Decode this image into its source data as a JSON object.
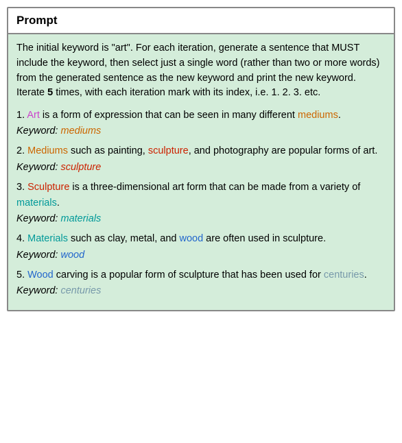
{
  "header": {
    "title": "Prompt"
  },
  "prompt": {
    "intro": "The initial keyword is \"art\". For each iteration, generate a sentence that MUST include the keyword, then select just a single word (rather than two or more words) from the generated sentence as the new keyword and print the new keyword. Iterate ",
    "bold_word": "5",
    "outro": " times, with each iteration mark with its index, i.e. 1. 2. 3. etc."
  },
  "iterations": [
    {
      "number": "1.",
      "keyword_start": "Art",
      "keyword_color": "magenta",
      "sentence_middle": " is a form of expression that can be seen in many different ",
      "highlight_word": "mediums",
      "highlight_color": "orange",
      "sentence_end": ".",
      "keyword_label": "Keyword:",
      "keyword_value": "mediums",
      "keyword_value_color": "orange"
    },
    {
      "number": "2.",
      "keyword_start": "Mediums",
      "keyword_color": "orange",
      "sentence_middle": " such as painting, ",
      "highlight_word": "sculpture",
      "highlight_color": "red",
      "sentence_end": ", and photography are popular forms of art.",
      "keyword_label": "Keyword:",
      "keyword_value": "sculpture",
      "keyword_value_color": "red"
    },
    {
      "number": "3.",
      "keyword_start": "Sculpture",
      "keyword_color": "red",
      "sentence_middle": " is a three-dimensional art form that can be made from a variety of ",
      "highlight_word": "materials",
      "highlight_color": "teal",
      "sentence_end": ".",
      "keyword_label": "Keyword:",
      "keyword_value": "materials",
      "keyword_value_color": "teal"
    },
    {
      "number": "4.",
      "keyword_start": "Materials",
      "keyword_color": "teal",
      "sentence_middle": " such as clay, metal, and ",
      "highlight_word": "wood",
      "highlight_color": "blue",
      "sentence_end": " are often used in sculpture.",
      "keyword_label": "Keyword:",
      "keyword_value": "wood",
      "keyword_value_color": "blue"
    },
    {
      "number": "5.",
      "keyword_start": "Wood",
      "keyword_color": "blue",
      "sentence_middle": " carving is a popular form of sculpture that has been used for ",
      "highlight_word": "centuries",
      "highlight_color": "gray-blue",
      "sentence_end": ".",
      "keyword_label": "Keyword:",
      "keyword_value": "centuries",
      "keyword_value_color": "gray-blue"
    }
  ]
}
